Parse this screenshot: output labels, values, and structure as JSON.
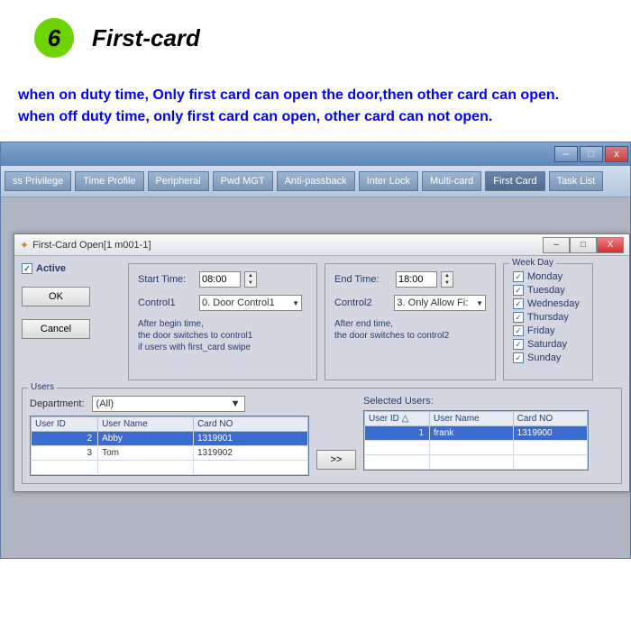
{
  "step": {
    "num": "6",
    "title": "First-card"
  },
  "desc1": "when on duty time, Only first card can open the door,then other card can open.",
  "desc2": "when off duty time, only first card can open, other card can not open.",
  "outer_window": {
    "min": "–",
    "max": "□",
    "close": "x"
  },
  "toolbar": {
    "items": [
      "ss Privilege",
      "Time Profile",
      "Peripheral",
      "Pwd MGT",
      "Anti-passback",
      "Inter Lock",
      "Multi-card",
      "First Card",
      "Task List"
    ],
    "active_index": 7
  },
  "dialog": {
    "title": "First-Card Open[1   m001-1]",
    "min": "–",
    "max": "□",
    "close": "X",
    "active_label": "Active",
    "ok": "OK",
    "cancel": "Cancel",
    "start": {
      "label": "Start Time:",
      "value": "08:00",
      "ctrl_label": "Control1",
      "ctrl_value": "0. Door Control1",
      "hint": "After begin time,\nthe door switches to control1\nif users with first_card  swipe"
    },
    "end": {
      "label": "End Time:",
      "value": "18:00",
      "ctrl_label": "Control2",
      "ctrl_value": "3. Only Allow Fi:",
      "hint": "After end time,\nthe door switches to control2"
    },
    "week": {
      "legend": "Week Day",
      "days": [
        "Monday",
        "Tuesday",
        "Wednesday",
        "Thursday",
        "Friday",
        "Saturday",
        "Sunday"
      ]
    },
    "users": {
      "legend": "Users",
      "dep_label": "Department:",
      "dep_value": "(All)",
      "headers": [
        "User ID",
        "User Name",
        "Card NO"
      ],
      "left": [
        {
          "id": "2",
          "name": "Abby",
          "card": "1319901",
          "selected": true
        },
        {
          "id": "3",
          "name": "Tom",
          "card": "1319902",
          "selected": false
        }
      ],
      "sel_label": "Selected Users:",
      "right": [
        {
          "id": "1",
          "name": "frank",
          "card": "1319900",
          "selected": true
        }
      ],
      "move": ">>"
    }
  }
}
